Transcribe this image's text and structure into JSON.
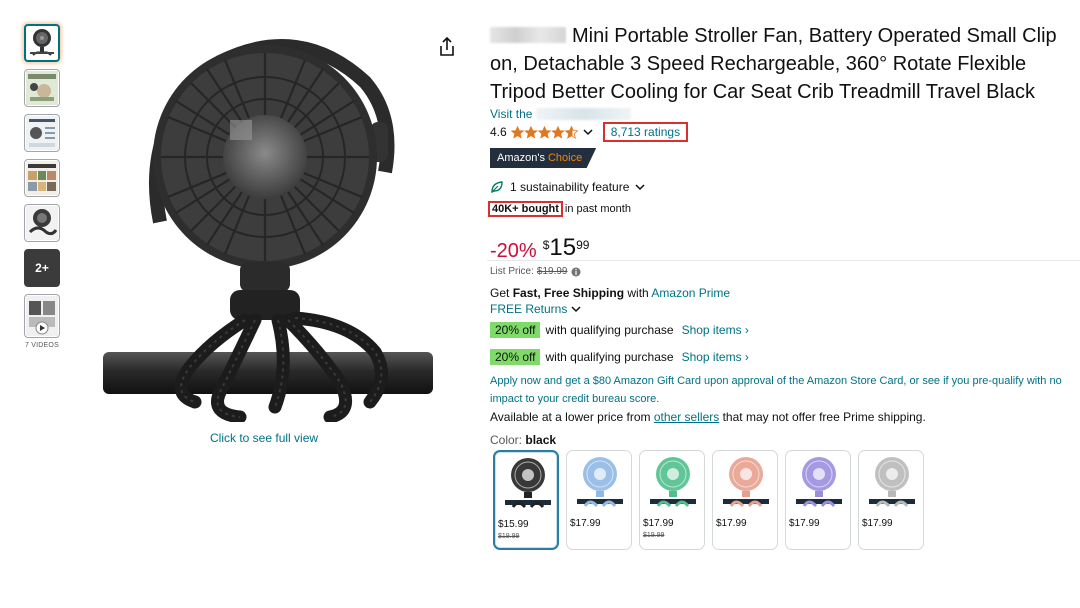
{
  "thumbnails": {
    "overlay_count": "2+",
    "videos_caption": "7 VIDEOS"
  },
  "image": {
    "caption": "Click to see full view"
  },
  "product": {
    "title": "Mini Portable Stroller Fan, Battery Operated Small Clip on, Detachable 3 Speed Rechargeable, 360° Rotate Flexible Tripod Better Cooling for Car Seat Crib Treadmill Travel Black",
    "visit_prefix": "Visit the",
    "rating": "4.6",
    "rating_stars": 4.6,
    "ratings_count": "8,713 ratings",
    "badge_prefix": "Amazon's",
    "badge_choice": "Choice",
    "sustainability": "1 sustainability feature",
    "bought": "40K+ bought",
    "bought_suffix": "in past month"
  },
  "price": {
    "discount": "-20%",
    "symbol": "$",
    "whole": "15",
    "fraction": "99",
    "list_label": "List Price:",
    "list_price": "$19.99"
  },
  "shipping": {
    "get": "Get",
    "fast_free": "Fast, Free Shipping",
    "with": "with",
    "prime": "Amazon Prime",
    "returns": "FREE Returns"
  },
  "offers": [
    {
      "tag": "20% off",
      "text": "with qualifying purchase",
      "link": "Shop items ›"
    },
    {
      "tag": "20% off",
      "text": "with qualifying purchase",
      "link": "Shop items ›"
    }
  ],
  "card_offer": "Apply now and get a $80 Amazon Gift Card upon approval of the Amazon Store Card, or see if you pre-qualify with no impact to your credit bureau score.",
  "availability": {
    "prefix": "Available at a lower price from",
    "link": "other sellers",
    "suffix": "that may not offer free Prime shipping."
  },
  "color": {
    "label": "Color:",
    "selected": "black"
  },
  "swatches": [
    {
      "price": "$15.99",
      "list": "$19.99",
      "color": "#222222",
      "selected": true
    },
    {
      "price": "$17.99",
      "list": "",
      "color": "#8fb8e6",
      "selected": false
    },
    {
      "price": "$17.99",
      "list": "$19.99",
      "color": "#4fbf8c",
      "selected": false
    },
    {
      "price": "$17.99",
      "list": "",
      "color": "#e8a08e",
      "selected": false
    },
    {
      "price": "$17.99",
      "list": "",
      "color": "#9b8ee0",
      "selected": false
    },
    {
      "price": "$17.99",
      "list": "",
      "color": "#b9b9b9",
      "selected": false
    }
  ],
  "colors": {
    "link": "#007185",
    "discount": "#cc0c39",
    "highlight_box": "#d6312c",
    "offer_tag": "#7fda69",
    "badge_bg": "#232f3e",
    "star": "#de7921"
  }
}
